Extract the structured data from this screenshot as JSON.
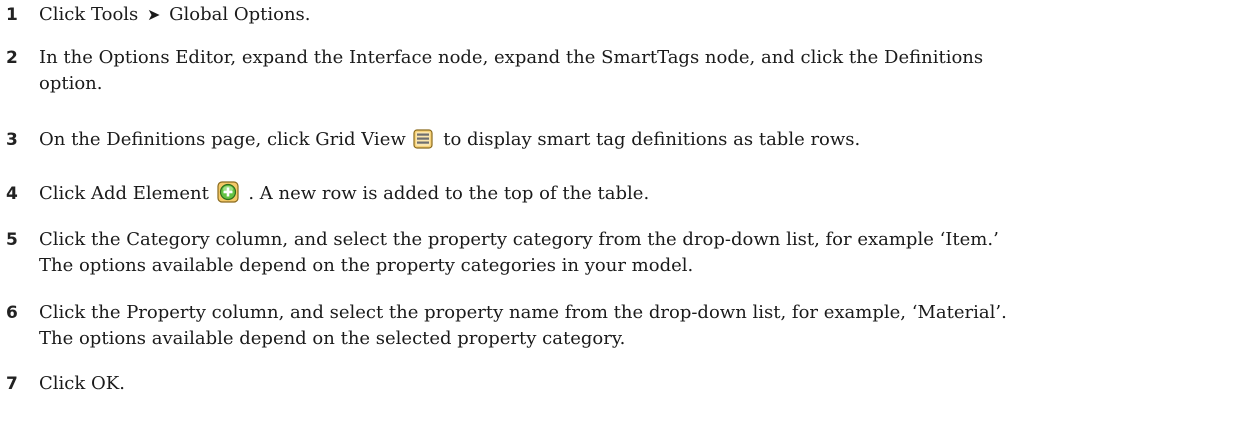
{
  "steps": [
    {
      "num": "1",
      "text_a": "Click Tools",
      "arrow": "➤",
      "text_b": "Global Options."
    },
    {
      "num": "2",
      "line1": "In the Options Editor, expand the Interface node, expand the SmartTags node, and click the Definitions",
      "line2": "option."
    },
    {
      "num": "3",
      "text_a": "On the Definitions page, click Grid View",
      "icon": "grid-view-icon",
      "text_b": "to display smart tag definitions as table rows."
    },
    {
      "num": "4",
      "text_a": "Click Add Element",
      "icon": "add-element-icon",
      "text_b": ". A new row is added to the top of the table."
    },
    {
      "num": "5",
      "line1": "Click the Category column, and select the property category from the drop-down list, for example ‘Item.’",
      "line2": "The options available depend on the property categories in your model."
    },
    {
      "num": "6",
      "line1": "Click the Property column, and select the property name from the drop-down list, for example, ‘Material’.",
      "line2": "The options available depend on the selected property category."
    },
    {
      "num": "7",
      "text_a": "Click OK."
    }
  ],
  "colors": {
    "text": "#1a1a1a",
    "grid_icon_fill": "#f3c867",
    "grid_icon_border": "#8a6a1d",
    "add_icon_fill": "#5cb83c",
    "add_icon_border": "#2f6e1c"
  }
}
